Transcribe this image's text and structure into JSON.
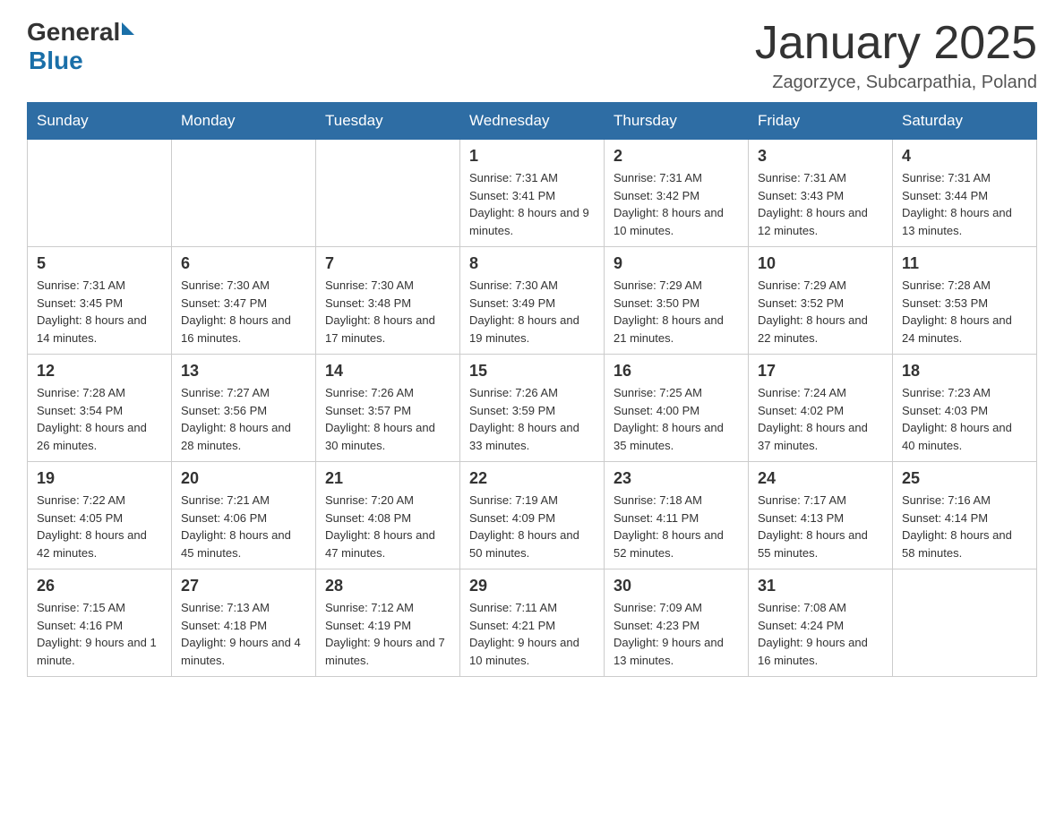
{
  "header": {
    "logo": {
      "general": "General",
      "triangle": "▶",
      "blue": "Blue"
    },
    "title": "January 2025",
    "subtitle": "Zagorzyce, Subcarpathia, Poland"
  },
  "weekdays": [
    "Sunday",
    "Monday",
    "Tuesday",
    "Wednesday",
    "Thursday",
    "Friday",
    "Saturday"
  ],
  "weeks": [
    {
      "days": [
        {
          "number": "",
          "info": ""
        },
        {
          "number": "",
          "info": ""
        },
        {
          "number": "",
          "info": ""
        },
        {
          "number": "1",
          "info": "Sunrise: 7:31 AM\nSunset: 3:41 PM\nDaylight: 8 hours and 9 minutes."
        },
        {
          "number": "2",
          "info": "Sunrise: 7:31 AM\nSunset: 3:42 PM\nDaylight: 8 hours and 10 minutes."
        },
        {
          "number": "3",
          "info": "Sunrise: 7:31 AM\nSunset: 3:43 PM\nDaylight: 8 hours and 12 minutes."
        },
        {
          "number": "4",
          "info": "Sunrise: 7:31 AM\nSunset: 3:44 PM\nDaylight: 8 hours and 13 minutes."
        }
      ]
    },
    {
      "days": [
        {
          "number": "5",
          "info": "Sunrise: 7:31 AM\nSunset: 3:45 PM\nDaylight: 8 hours and 14 minutes."
        },
        {
          "number": "6",
          "info": "Sunrise: 7:30 AM\nSunset: 3:47 PM\nDaylight: 8 hours and 16 minutes."
        },
        {
          "number": "7",
          "info": "Sunrise: 7:30 AM\nSunset: 3:48 PM\nDaylight: 8 hours and 17 minutes."
        },
        {
          "number": "8",
          "info": "Sunrise: 7:30 AM\nSunset: 3:49 PM\nDaylight: 8 hours and 19 minutes."
        },
        {
          "number": "9",
          "info": "Sunrise: 7:29 AM\nSunset: 3:50 PM\nDaylight: 8 hours and 21 minutes."
        },
        {
          "number": "10",
          "info": "Sunrise: 7:29 AM\nSunset: 3:52 PM\nDaylight: 8 hours and 22 minutes."
        },
        {
          "number": "11",
          "info": "Sunrise: 7:28 AM\nSunset: 3:53 PM\nDaylight: 8 hours and 24 minutes."
        }
      ]
    },
    {
      "days": [
        {
          "number": "12",
          "info": "Sunrise: 7:28 AM\nSunset: 3:54 PM\nDaylight: 8 hours and 26 minutes."
        },
        {
          "number": "13",
          "info": "Sunrise: 7:27 AM\nSunset: 3:56 PM\nDaylight: 8 hours and 28 minutes."
        },
        {
          "number": "14",
          "info": "Sunrise: 7:26 AM\nSunset: 3:57 PM\nDaylight: 8 hours and 30 minutes."
        },
        {
          "number": "15",
          "info": "Sunrise: 7:26 AM\nSunset: 3:59 PM\nDaylight: 8 hours and 33 minutes."
        },
        {
          "number": "16",
          "info": "Sunrise: 7:25 AM\nSunset: 4:00 PM\nDaylight: 8 hours and 35 minutes."
        },
        {
          "number": "17",
          "info": "Sunrise: 7:24 AM\nSunset: 4:02 PM\nDaylight: 8 hours and 37 minutes."
        },
        {
          "number": "18",
          "info": "Sunrise: 7:23 AM\nSunset: 4:03 PM\nDaylight: 8 hours and 40 minutes."
        }
      ]
    },
    {
      "days": [
        {
          "number": "19",
          "info": "Sunrise: 7:22 AM\nSunset: 4:05 PM\nDaylight: 8 hours and 42 minutes."
        },
        {
          "number": "20",
          "info": "Sunrise: 7:21 AM\nSunset: 4:06 PM\nDaylight: 8 hours and 45 minutes."
        },
        {
          "number": "21",
          "info": "Sunrise: 7:20 AM\nSunset: 4:08 PM\nDaylight: 8 hours and 47 minutes."
        },
        {
          "number": "22",
          "info": "Sunrise: 7:19 AM\nSunset: 4:09 PM\nDaylight: 8 hours and 50 minutes."
        },
        {
          "number": "23",
          "info": "Sunrise: 7:18 AM\nSunset: 4:11 PM\nDaylight: 8 hours and 52 minutes."
        },
        {
          "number": "24",
          "info": "Sunrise: 7:17 AM\nSunset: 4:13 PM\nDaylight: 8 hours and 55 minutes."
        },
        {
          "number": "25",
          "info": "Sunrise: 7:16 AM\nSunset: 4:14 PM\nDaylight: 8 hours and 58 minutes."
        }
      ]
    },
    {
      "days": [
        {
          "number": "26",
          "info": "Sunrise: 7:15 AM\nSunset: 4:16 PM\nDaylight: 9 hours and 1 minute."
        },
        {
          "number": "27",
          "info": "Sunrise: 7:13 AM\nSunset: 4:18 PM\nDaylight: 9 hours and 4 minutes."
        },
        {
          "number": "28",
          "info": "Sunrise: 7:12 AM\nSunset: 4:19 PM\nDaylight: 9 hours and 7 minutes."
        },
        {
          "number": "29",
          "info": "Sunrise: 7:11 AM\nSunset: 4:21 PM\nDaylight: 9 hours and 10 minutes."
        },
        {
          "number": "30",
          "info": "Sunrise: 7:09 AM\nSunset: 4:23 PM\nDaylight: 9 hours and 13 minutes."
        },
        {
          "number": "31",
          "info": "Sunrise: 7:08 AM\nSunset: 4:24 PM\nDaylight: 9 hours and 16 minutes."
        },
        {
          "number": "",
          "info": ""
        }
      ]
    }
  ]
}
